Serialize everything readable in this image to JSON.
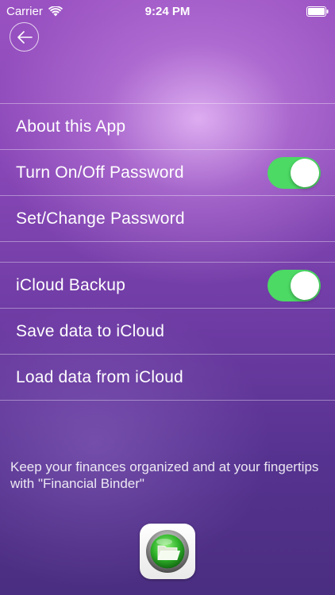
{
  "status_bar": {
    "carrier": "Carrier",
    "time": "9:24 PM"
  },
  "nav": {
    "back_icon": "back-arrow-circle-icon"
  },
  "sections": [
    {
      "rows": [
        {
          "label": "About this App",
          "has_toggle": false
        },
        {
          "label": "Turn On/Off Password",
          "has_toggle": true,
          "toggle_on": true
        },
        {
          "label": "Set/Change Password",
          "has_toggle": false
        }
      ]
    },
    {
      "rows": [
        {
          "label": "iCloud Backup",
          "has_toggle": true,
          "toggle_on": true
        },
        {
          "label": "Save data to iCloud",
          "has_toggle": false
        },
        {
          "label": "Load data from iCloud",
          "has_toggle": false
        }
      ]
    }
  ],
  "footer": {
    "tagline": "Keep your finances organized and at your fingertips with \"Financial Binder\"",
    "app_icon": "financial-binder-folder-icon"
  },
  "colors": {
    "toggle_on": "#4cd964",
    "background_top": "#9a52c2",
    "background_bottom": "#4a2e80"
  }
}
